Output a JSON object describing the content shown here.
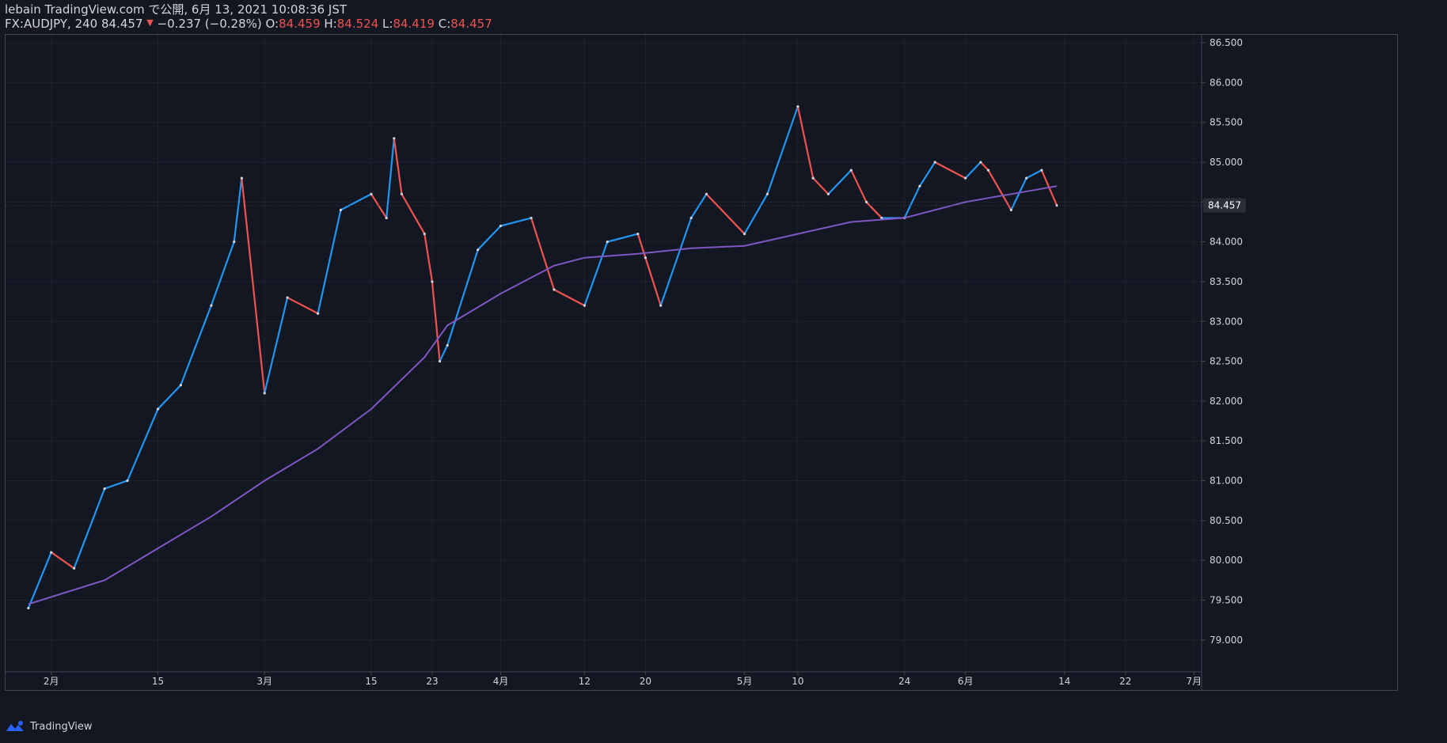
{
  "header": {
    "line1": "lebain TradingView.com で公開, 6月 13, 2021 10:08:36 JST",
    "symbol": "FX:AUDJPY, 240",
    "last": "84.457",
    "change": "−0.237 (−0.28%)",
    "o_label": "O:",
    "o_val": "84.459",
    "h_label": "H:",
    "h_val": "84.524",
    "l_label": "L:",
    "l_val": "84.419",
    "c_label": "C:",
    "c_val": "84.457"
  },
  "footer": {
    "brand": "TradingView"
  },
  "colors": {
    "bg": "#131722",
    "up": "#2196f3",
    "down": "#ef5350",
    "ma": "#7e57c2",
    "grid": "#1e222d",
    "text": "#d1d4dc"
  },
  "chart_data": {
    "type": "line",
    "title": "",
    "ylim": [
      78.6,
      86.6
    ],
    "y_ticks": [
      "86.500",
      "86.000",
      "85.500",
      "85.000",
      "84.500",
      "84.000",
      "83.500",
      "83.000",
      "82.500",
      "82.000",
      "81.500",
      "81.000",
      "80.500",
      "80.000",
      "79.500",
      "79.000"
    ],
    "current_price_label": "84.457",
    "x_ticks": [
      {
        "label": "2月",
        "x": "2021-02-01"
      },
      {
        "label": "15",
        "x": "2021-02-15"
      },
      {
        "label": "3月",
        "x": "2021-03-01"
      },
      {
        "label": "15",
        "x": "2021-03-15"
      },
      {
        "label": "23",
        "x": "2021-03-23"
      },
      {
        "label": "4月",
        "x": "2021-04-01"
      },
      {
        "label": "12",
        "x": "2021-04-12"
      },
      {
        "label": "20",
        "x": "2021-04-20"
      },
      {
        "label": "5月",
        "x": "2021-05-03"
      },
      {
        "label": "10",
        "x": "2021-05-10"
      },
      {
        "label": "24",
        "x": "2021-05-24"
      },
      {
        "label": "6月",
        "x": "2021-06-01"
      },
      {
        "label": "14",
        "x": "2021-06-14"
      },
      {
        "label": "22",
        "x": "2021-06-22"
      },
      {
        "label": "7月",
        "x": "2021-07-01"
      }
    ],
    "series": [
      {
        "kind": "price",
        "x": [
          "2021-01-29",
          "2021-02-01",
          "2021-02-04",
          "2021-02-08",
          "2021-02-11",
          "2021-02-15",
          "2021-02-18",
          "2021-02-22",
          "2021-02-25",
          "2021-02-26",
          "2021-03-01",
          "2021-03-04",
          "2021-03-08",
          "2021-03-11",
          "2021-03-15",
          "2021-03-17",
          "2021-03-18",
          "2021-03-19",
          "2021-03-22",
          "2021-03-23",
          "2021-03-24",
          "2021-03-25",
          "2021-03-29",
          "2021-04-01",
          "2021-04-05",
          "2021-04-08",
          "2021-04-12",
          "2021-04-15",
          "2021-04-19",
          "2021-04-20",
          "2021-04-22",
          "2021-04-26",
          "2021-04-28",
          "2021-05-03",
          "2021-05-06",
          "2021-05-10",
          "2021-05-12",
          "2021-05-14",
          "2021-05-17",
          "2021-05-19",
          "2021-05-21",
          "2021-05-24",
          "2021-05-26",
          "2021-05-28",
          "2021-06-01",
          "2021-06-03",
          "2021-06-04",
          "2021-06-07",
          "2021-06-09",
          "2021-06-11",
          "2021-06-13"
        ],
        "values": [
          79.4,
          80.1,
          79.9,
          80.9,
          81.0,
          81.9,
          82.2,
          83.2,
          84.0,
          84.8,
          82.1,
          83.3,
          83.1,
          84.4,
          84.6,
          84.3,
          85.3,
          84.6,
          84.1,
          83.5,
          82.5,
          82.7,
          83.9,
          84.2,
          84.3,
          83.4,
          83.2,
          84.0,
          84.1,
          83.8,
          83.2,
          84.3,
          84.6,
          84.1,
          84.6,
          85.7,
          84.8,
          84.6,
          84.9,
          84.5,
          84.3,
          84.3,
          84.7,
          85.0,
          84.8,
          85.0,
          84.9,
          84.4,
          84.8,
          84.9,
          84.457
        ]
      },
      {
        "kind": "moving-average",
        "x": [
          "2021-01-29",
          "2021-02-08",
          "2021-02-15",
          "2021-02-22",
          "2021-03-01",
          "2021-03-08",
          "2021-03-15",
          "2021-03-22",
          "2021-03-25",
          "2021-04-01",
          "2021-04-08",
          "2021-04-12",
          "2021-04-19",
          "2021-04-26",
          "2021-05-03",
          "2021-05-10",
          "2021-05-17",
          "2021-05-24",
          "2021-06-01",
          "2021-06-07",
          "2021-06-13"
        ],
        "values": [
          79.45,
          79.75,
          80.15,
          80.55,
          81.0,
          81.4,
          81.9,
          82.55,
          82.95,
          83.35,
          83.7,
          83.8,
          83.85,
          83.92,
          83.95,
          84.1,
          84.25,
          84.3,
          84.5,
          84.6,
          84.7
        ]
      }
    ]
  }
}
